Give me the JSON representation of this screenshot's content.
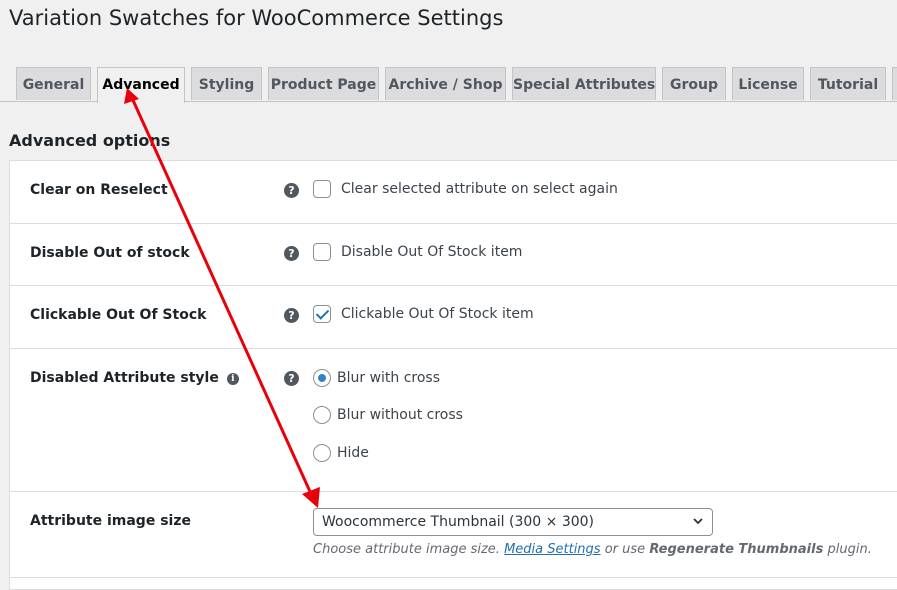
{
  "page": {
    "title": "Variation Swatches for WooCommerce Settings"
  },
  "tabs": [
    {
      "label": "General",
      "active": false
    },
    {
      "label": "Advanced",
      "active": true
    },
    {
      "label": "Styling",
      "active": false
    },
    {
      "label": "Product Page",
      "active": false
    },
    {
      "label": "Archive / Shop",
      "active": false
    },
    {
      "label": "Special Attributes",
      "active": false
    },
    {
      "label": "Group",
      "active": false
    },
    {
      "label": "License",
      "active": false
    },
    {
      "label": "Tutorial",
      "active": false
    }
  ],
  "section": {
    "title": "Advanced options"
  },
  "settings": {
    "clear_on_reselect": {
      "label": "Clear on Reselect",
      "checkbox_label": "Clear selected attribute on select again",
      "checked": false
    },
    "disable_out_of_stock": {
      "label": "Disable Out of stock",
      "checkbox_label": "Disable Out Of Stock item",
      "checked": false
    },
    "clickable_out_of_stock": {
      "label": "Clickable Out Of Stock",
      "checkbox_label": "Clickable Out Of Stock item",
      "checked": true
    },
    "disabled_attribute_style": {
      "label": "Disabled Attribute style",
      "options": [
        "Blur with cross",
        "Blur without cross",
        "Hide"
      ],
      "selected": "Blur with cross"
    },
    "attribute_image_size": {
      "label": "Attribute image size",
      "selected": "Woocommerce Thumbnail (300 × 300)",
      "description_prefix": "Choose attribute image size.",
      "description_link": "Media Settings",
      "description_middle": "or use",
      "description_bold": "Regenerate Thumbnails",
      "description_suffix": "plugin."
    }
  },
  "icons": {
    "help": "?",
    "info": "i"
  },
  "colors": {
    "accent": "#2271b1",
    "annotation_arrow": "#e8000b"
  }
}
